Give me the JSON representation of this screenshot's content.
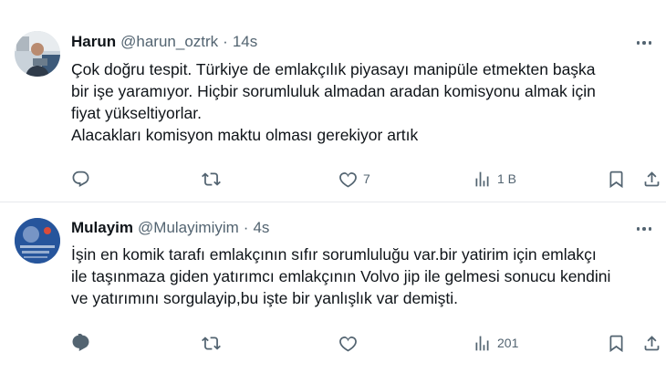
{
  "tweets": [
    {
      "author_name": "Harun",
      "handle": "@harun_oztrk",
      "separator": "·",
      "time": "14s",
      "text_lines": [
        "Çok doğru tespit. Türkiye de emlakçılık piyasayı manipüle etmekten başka",
        "bir işe yaramıyor. Hiçbir sorumluluk almadan aradan komisyonu almak için",
        "fiyat yükseltiyorlar.",
        "Alacakları komisyon maktu olması gerekiyor artık"
      ],
      "reply_count": "",
      "retweet_count": "",
      "like_count": "7",
      "view_count": "1 B"
    },
    {
      "author_name": "Mulayim",
      "handle": "@Mulayimiyim",
      "separator": "·",
      "time": "4s",
      "text_lines": [
        "İşin en komik tarafı emlakçının sıfır sorumluluğu var.bir yatirim için emlakçı",
        "ile taşınmaza giden yatırımcı emlakçının Volvo jip ile gelmesi sonucu kendini",
        "ve yatırımını sorgulayip,bu işte bir yanlışlık var demişti."
      ],
      "reply_count": "",
      "retweet_count": "",
      "like_count": "",
      "view_count": "201"
    }
  ],
  "colors": {
    "text_primary": "#0f1419",
    "text_secondary": "#536471",
    "divider": "#e6e9ec",
    "background": "#ffffff"
  },
  "icons": {
    "more": "more-dots-icon",
    "reply": "reply-icon",
    "retweet": "retweet-icon",
    "like": "heart-icon",
    "views": "views-chart-icon",
    "bookmark": "bookmark-icon",
    "share": "share-icon"
  }
}
